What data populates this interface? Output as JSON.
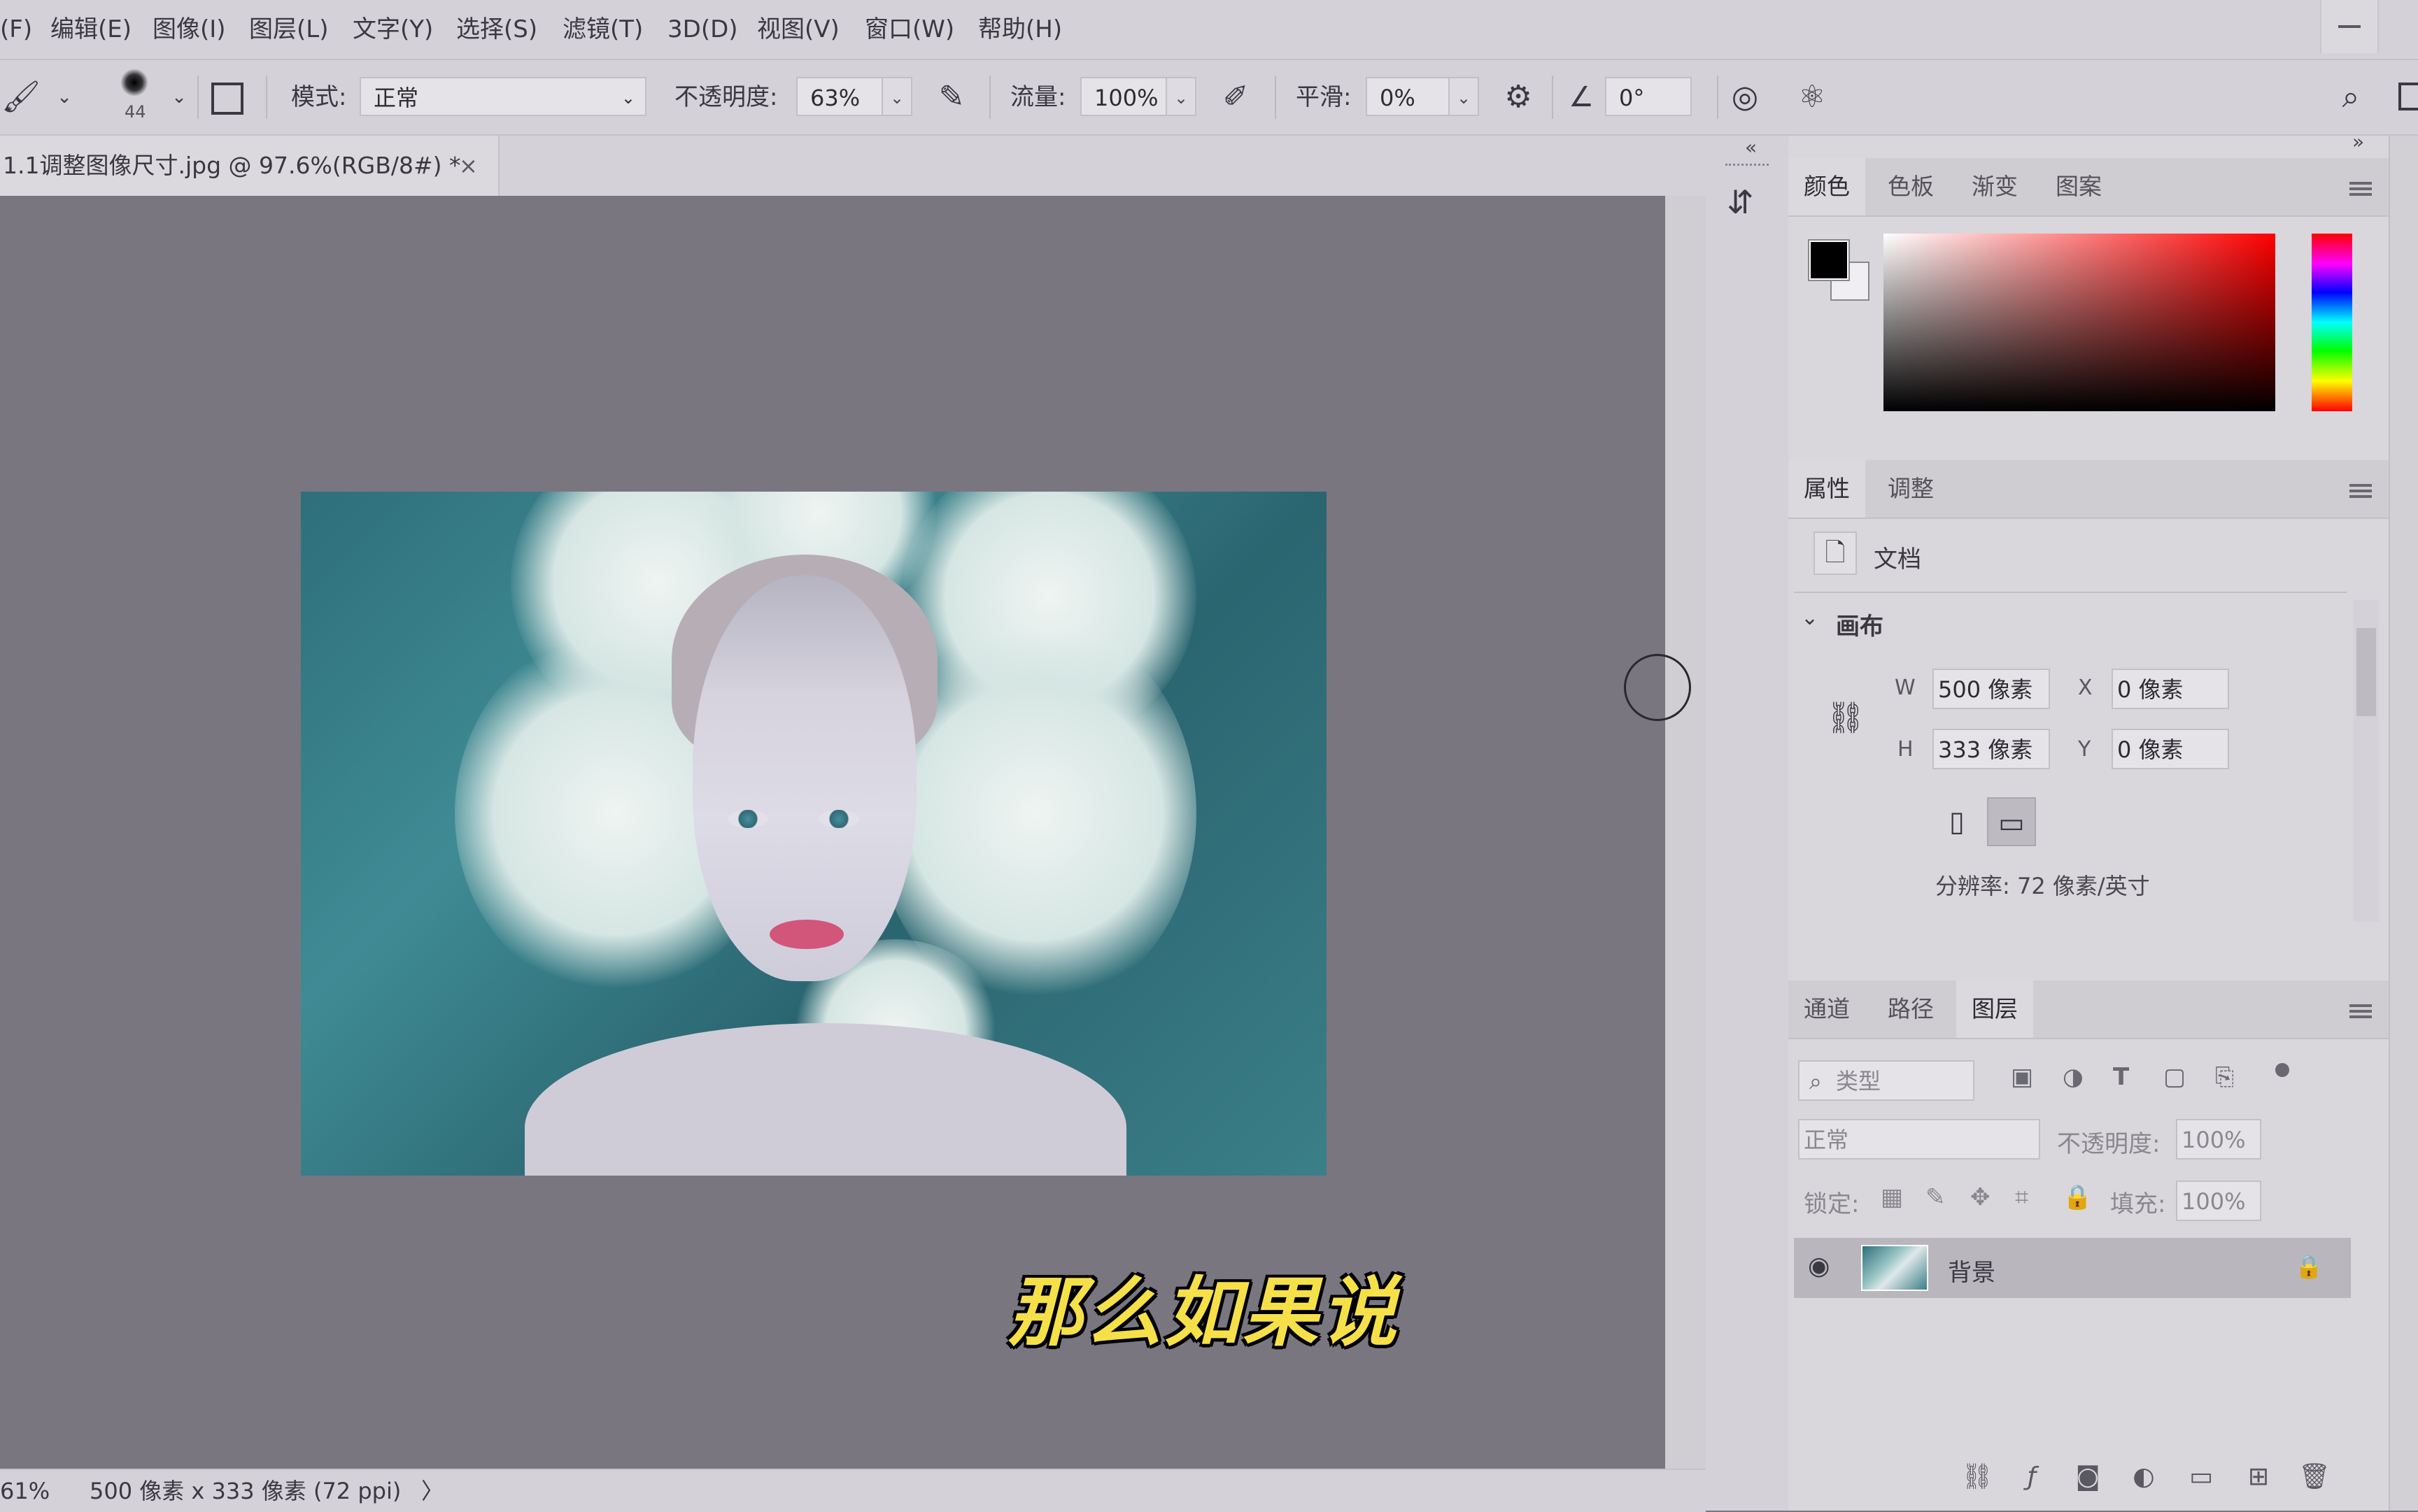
{
  "menubar": {
    "items": [
      "(F)",
      "编辑(E)",
      "图像(I)",
      "图层(L)",
      "文字(Y)",
      "选择(S)",
      "滤镜(T)",
      "3D(D)",
      "视图(V)",
      "窗口(W)",
      "帮助(H)"
    ]
  },
  "options": {
    "brush_size": "44",
    "mode_label": "模式:",
    "mode_value": "正常",
    "opacity_label": "不透明度:",
    "opacity_value": "63%",
    "flow_label": "流量:",
    "flow_value": "100%",
    "smooth_label": "平滑:",
    "smooth_value": "0%",
    "angle_value": "0°"
  },
  "document": {
    "tab_title": "1.1调整图像尺寸.jpg @ 97.6%(RGB/8#) *",
    "close": "×"
  },
  "subtitle": "那么如果说",
  "status": {
    "zoom": "61%",
    "info": "500 像素 x 333 像素 (72 ppi)",
    "arrow": "〉"
  },
  "color_panel": {
    "tabs": [
      "颜色",
      "色板",
      "渐变",
      "图案"
    ]
  },
  "properties_panel": {
    "tabs": [
      "属性",
      "调整"
    ],
    "doc_label": "文档",
    "section": "画布",
    "w_label": "W",
    "w_value": "500 像素",
    "h_label": "H",
    "h_value": "333 像素",
    "x_label": "X",
    "x_value": "0 像素",
    "y_label": "Y",
    "y_value": "0 像素",
    "resolution": "分辨率: 72 像素/英寸"
  },
  "layers_panel": {
    "tabs": [
      "通道",
      "路径",
      "图层"
    ],
    "filter_label": "类型",
    "blend_mode": "正常",
    "opacity_label": "不透明度:",
    "opacity_value": "100%",
    "lock_label": "锁定:",
    "fill_label": "填充:",
    "fill_value": "100%",
    "layer_name": "背景"
  }
}
